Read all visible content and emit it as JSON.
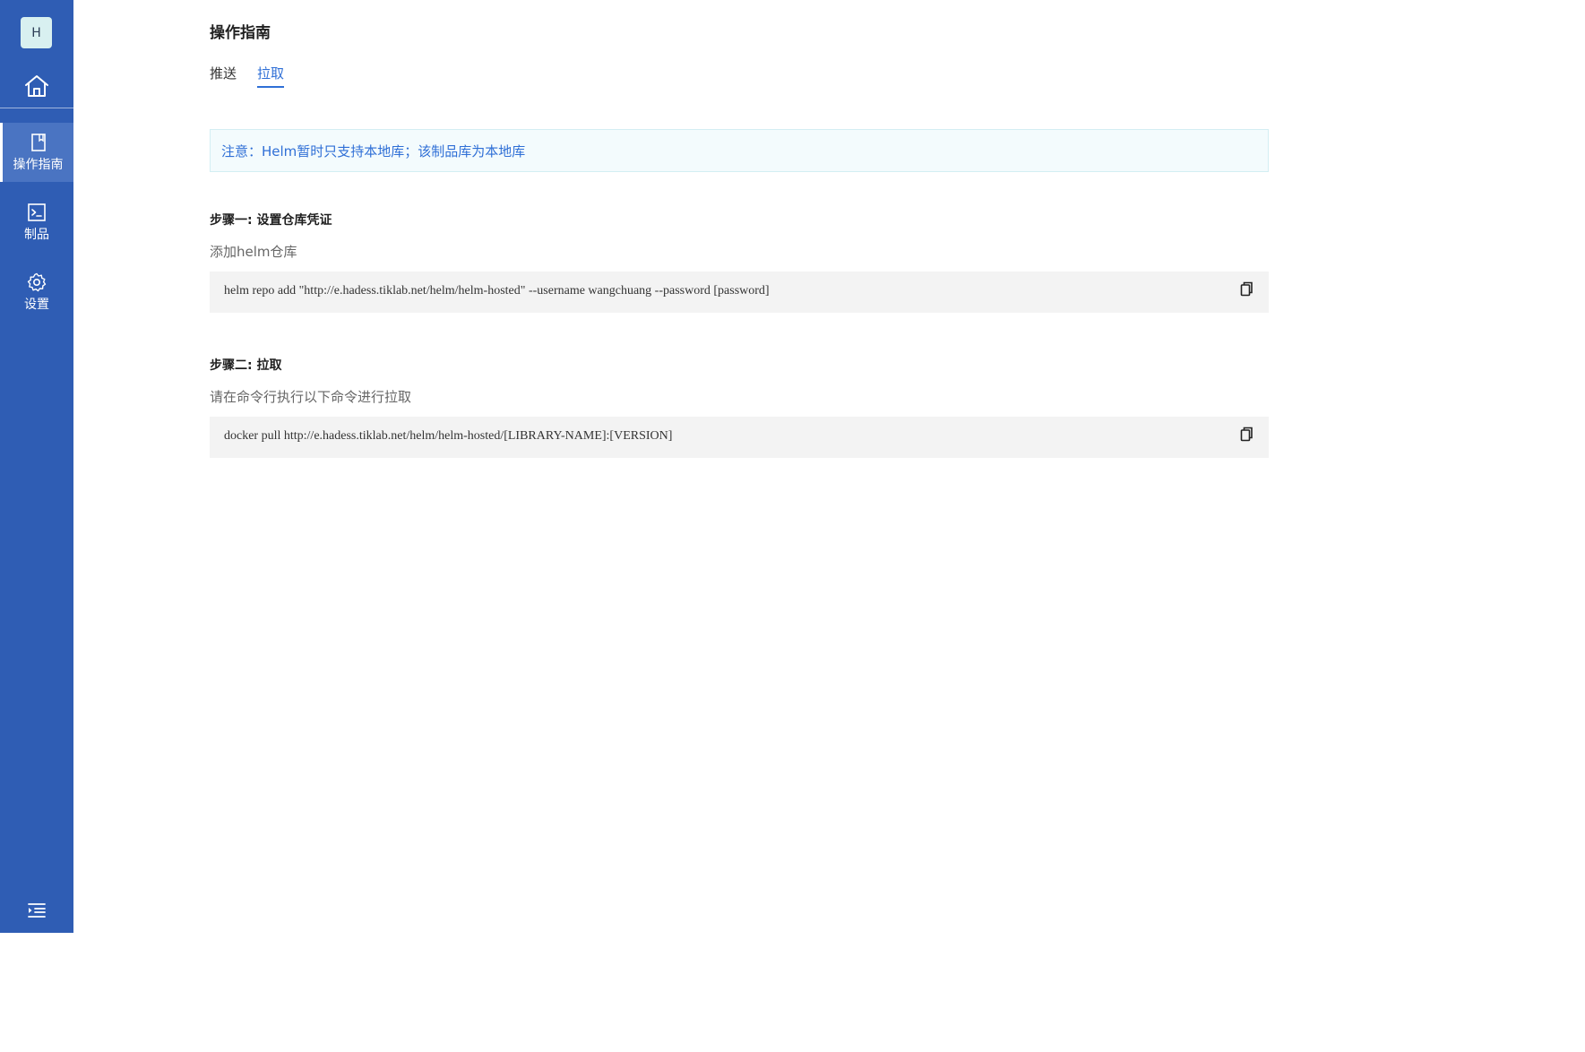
{
  "sidebar": {
    "avatar_letter": "H",
    "home_icon": "home-icon",
    "items": [
      {
        "label": "操作指南",
        "icon": "book-icon",
        "active": true
      },
      {
        "label": "制品",
        "icon": "terminal-icon",
        "active": false
      },
      {
        "label": "设置",
        "icon": "gear-icon",
        "active": false
      }
    ],
    "collapse_icon": "menu-expand-icon"
  },
  "main": {
    "title": "操作指南",
    "tabs": [
      {
        "label": "推送",
        "active": false
      },
      {
        "label": "拉取",
        "active": true
      }
    ],
    "notice": "注意：Helm暂时只支持本地库；该制品库为本地库",
    "steps": [
      {
        "title": "步骤一: 设置仓库凭证",
        "desc": "添加helm仓库",
        "code": "helm repo add \"http://e.hadess.tiklab.net/helm/helm-hosted\" --username wangchuang --password [password]",
        "copy_icon": "copy-icon"
      },
      {
        "title": "步骤二: 拉取",
        "desc": "请在命令行执行以下命令进行拉取",
        "code": "docker pull http://e.hadess.tiklab.net/helm/helm-hosted/[LIBRARY-NAME]:[VERSION]",
        "copy_icon": "copy-icon"
      }
    ]
  },
  "colors": {
    "sidebar_bg": "#2f5db4",
    "sidebar_active_bg": "#4a74c2",
    "accent": "#2f6fd6",
    "notice_bg": "#f3fbfd",
    "code_bg": "#f3f3f3"
  }
}
